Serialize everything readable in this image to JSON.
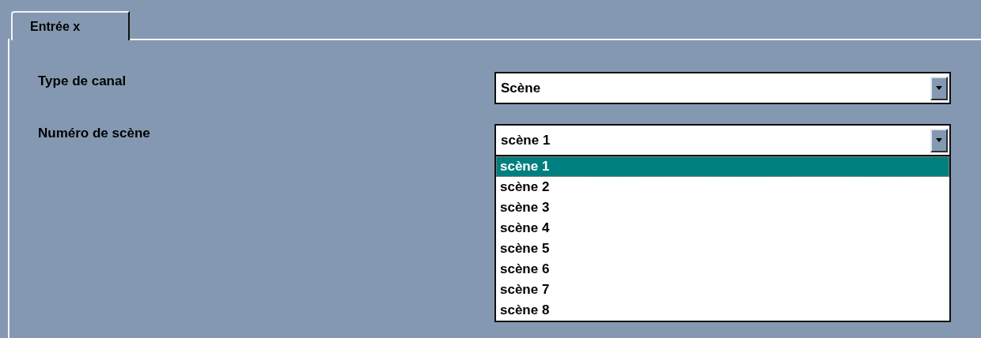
{
  "tabs": [
    {
      "label": "Entrée x",
      "selected": true
    }
  ],
  "fields": [
    {
      "label": "Type de canal",
      "value": "Scène"
    },
    {
      "label": "Numéro de scène",
      "value": "scène 1",
      "expanded": true,
      "options": [
        {
          "label": "scène 1",
          "selected": true
        },
        {
          "label": "scène 2",
          "selected": false
        },
        {
          "label": "scène 3",
          "selected": false
        },
        {
          "label": "scène 4",
          "selected": false
        },
        {
          "label": "scène 5",
          "selected": false
        },
        {
          "label": "scène 6",
          "selected": false
        },
        {
          "label": "scène 7",
          "selected": false
        },
        {
          "label": "scène 8",
          "selected": false
        }
      ]
    }
  ]
}
